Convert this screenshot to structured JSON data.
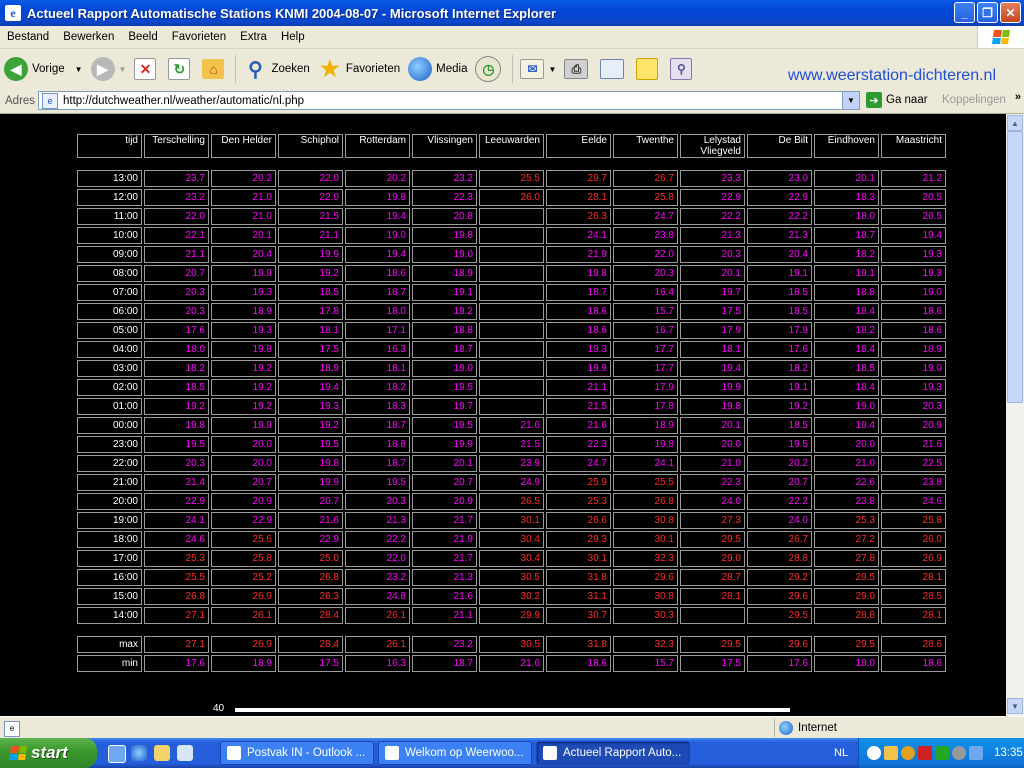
{
  "window": {
    "title": "Actueel Rapport Automatische Stations KNMI 2004-08-07 - Microsoft Internet Explorer",
    "controls": {
      "minimize": "_",
      "maximize": "❐",
      "close": "✕"
    }
  },
  "menu": [
    "Bestand",
    "Bewerken",
    "Beeld",
    "Favorieten",
    "Extra",
    "Help"
  ],
  "toolbar": {
    "back": "Vorige",
    "search": "Zoeken",
    "favorites": "Favorieten",
    "media": "Media",
    "brand": "www.weerstation-dichteren.nl"
  },
  "address": {
    "label": "Adres",
    "url": "http://dutchweather.nl/weather/automatic/nl.php",
    "go": "Ga naar",
    "links": "Koppelingen",
    "more": "»"
  },
  "table": {
    "time_header": "tijd",
    "stations": [
      "Terschelling",
      "Den Helder",
      "Schiphol",
      "Rotterdam",
      "Vlissingen",
      "Leeuwarden",
      "Eelde",
      "Twenthe",
      "Lelystad Vliegveld",
      "De Bilt",
      "Eindhoven",
      "Maastricht"
    ],
    "rows": [
      {
        "time": "13:00",
        "values": [
          "23.7",
          "20.2",
          "22.0",
          "20.2",
          "23.2",
          "25.5",
          "29.7",
          "26.7",
          "23.3",
          "23.0",
          "20.1",
          "21.2"
        ]
      },
      {
        "time": "12:00",
        "values": [
          "23.2",
          "21.0",
          "22.0",
          "19.8",
          "22.3",
          "26.0",
          "28.1",
          "25.8",
          "22.9",
          "22.9",
          "18.3",
          "20.5"
        ]
      },
      {
        "time": "11:00",
        "values": [
          "22.0",
          "21.0",
          "21.5",
          "19.4",
          "20.8",
          "",
          "26.3",
          "24.7",
          "22.2",
          "22.2",
          "18.0",
          "20.5"
        ]
      },
      {
        "time": "10:00",
        "values": [
          "22.1",
          "20.1",
          "21.1",
          "19.0",
          "19.8",
          "",
          "24.1",
          "23.8",
          "21.3",
          "21.3",
          "18.7",
          "19.4"
        ]
      },
      {
        "time": "09:00",
        "values": [
          "21.1",
          "20.4",
          "19.9",
          "19.4",
          "19.0",
          "",
          "21.9",
          "22.0",
          "20.3",
          "20.4",
          "18.2",
          "19.3"
        ]
      },
      {
        "time": "08:00",
        "values": [
          "20.7",
          "19.9",
          "19.2",
          "18.6",
          "18.9",
          "",
          "19.8",
          "20.3",
          "20.1",
          "19.1",
          "19.1",
          "19.3"
        ]
      },
      {
        "time": "07:00",
        "values": [
          "20.3",
          "19.3",
          "18.5",
          "18.7",
          "19.1",
          "",
          "18.7",
          "16.4",
          "19.7",
          "18.5",
          "18.8",
          "19.0"
        ]
      },
      {
        "time": "06:00",
        "values": [
          "20.3",
          "18.9",
          "17.8",
          "18.0",
          "19.2",
          "",
          "18.6",
          "15.7",
          "17.5",
          "18.5",
          "18.4",
          "18.6"
        ]
      },
      {
        "time": "05:00",
        "values": [
          "17.6",
          "19.3",
          "18.1",
          "17.1",
          "18.8",
          "",
          "18.6",
          "16.7",
          "17.9",
          "17.9",
          "18.2",
          "18.6"
        ]
      },
      {
        "time": "04:00",
        "values": [
          "18.0",
          "19.8",
          "17.5",
          "16.3",
          "18.7",
          "",
          "19.3",
          "17.7",
          "18.1",
          "17.6",
          "18.4",
          "18.9"
        ]
      },
      {
        "time": "03:00",
        "values": [
          "18.2",
          "19.2",
          "18.9",
          "18.1",
          "19.0",
          "",
          "19.9",
          "17.7",
          "19.4",
          "18.2",
          "18.5",
          "19.0"
        ]
      },
      {
        "time": "02:00",
        "values": [
          "18.5",
          "19.2",
          "19.4",
          "18.2",
          "19.5",
          "",
          "21.1",
          "17.9",
          "19.9",
          "19.1",
          "18.4",
          "19.3"
        ]
      },
      {
        "time": "01:00",
        "values": [
          "19.2",
          "19.2",
          "19.3",
          "18.3",
          "19.7",
          "",
          "21.5",
          "17.8",
          "19.8",
          "19.2",
          "19.0",
          "20.3"
        ]
      },
      {
        "time": "00:00",
        "values": [
          "19.8",
          "19.9",
          "19.2",
          "18.7",
          "19.5",
          "21.6",
          "21.6",
          "18.9",
          "20.1",
          "18.5",
          "19.4",
          "20.9"
        ]
      },
      {
        "time": "23:00",
        "values": [
          "19.5",
          "20.0",
          "19.5",
          "18.8",
          "19.9",
          "21.5",
          "22.3",
          "19.8",
          "20.0",
          "19.5",
          "20.0",
          "21.6"
        ]
      },
      {
        "time": "22:00",
        "values": [
          "20.3",
          "20.0",
          "19.8",
          "18.7",
          "20.1",
          "23.9",
          "24.7",
          "24.1",
          "21.0",
          "20.2",
          "21.0",
          "22.5"
        ]
      },
      {
        "time": "21:00",
        "values": [
          "21.4",
          "20.7",
          "19.9",
          "19.5",
          "20.7",
          "24.9",
          "25.9",
          "25.5",
          "22.3",
          "20.7",
          "22.6",
          "23.8"
        ]
      },
      {
        "time": "20:00",
        "values": [
          "22.9",
          "20.9",
          "20.7",
          "20.3",
          "20.9",
          "26.5",
          "25.3",
          "26.8",
          "24.0",
          "22.2",
          "23.8",
          "24.6"
        ]
      },
      {
        "time": "19:00",
        "values": [
          "24.1",
          "22.9",
          "21.6",
          "21.3",
          "21.7",
          "30.1",
          "26.6",
          "30.8",
          "27.3",
          "24.0",
          "25.3",
          "25.8"
        ]
      },
      {
        "time": "18:00",
        "values": [
          "24.6",
          "25.6",
          "22.9",
          "22.2",
          "21.9",
          "30.4",
          "29.3",
          "30.1",
          "29.5",
          "26.7",
          "27.2",
          "26.0"
        ]
      },
      {
        "time": "17:00",
        "values": [
          "25.3",
          "25.8",
          "25.0",
          "22.0",
          "21.7",
          "30.4",
          "30.1",
          "32.3",
          "29.0",
          "28.8",
          "27.8",
          "26.9"
        ]
      },
      {
        "time": "16:00",
        "values": [
          "25.5",
          "25.2",
          "26.8",
          "23.2",
          "21.3",
          "30.5",
          "31.8",
          "29.6",
          "28.7",
          "29.2",
          "29.5",
          "28.1"
        ]
      },
      {
        "time": "15:00",
        "values": [
          "26.8",
          "26.9",
          "26.3",
          "24.8",
          "21.6",
          "30.2",
          "31.1",
          "30.8",
          "28.1",
          "29.6",
          "29.0",
          "28.5"
        ]
      },
      {
        "time": "14:00",
        "values": [
          "27.1",
          "26.1",
          "28.4",
          "26.1",
          "21.1",
          "29.9",
          "30.7",
          "30.3",
          "",
          "29.5",
          "28.8",
          "28.1"
        ]
      }
    ],
    "summary": [
      {
        "label": "max",
        "values": [
          "27.1",
          "26.9",
          "28.4",
          "26.1",
          "23.2",
          "30.5",
          "31.8",
          "32.3",
          "29.5",
          "29.6",
          "29.5",
          "28.6"
        ]
      },
      {
        "label": "min",
        "values": [
          "17.6",
          "18.9",
          "17.5",
          "16.3",
          "18.7",
          "21.6",
          "18.6",
          "15.7",
          "17.5",
          "17.6",
          "18.0",
          "18.6"
        ]
      }
    ],
    "colors": {
      "cool": "#FF00FF",
      "warm": "#FF2A2A",
      "threshold": 25
    }
  },
  "page_bottom": {
    "number": "40"
  },
  "status": {
    "zone": "Internet"
  },
  "taskbar": {
    "start": "start",
    "tasks": [
      "Postvak IN - Outlook ...",
      "Welkom op Weerwoo...",
      "Actueel Rapport Auto..."
    ],
    "lang": "NL",
    "clock": "13:35"
  }
}
